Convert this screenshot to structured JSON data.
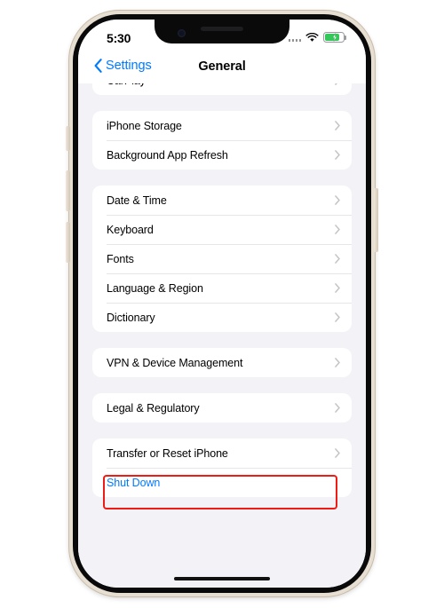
{
  "device": {
    "frame_color": "#e8dfd3",
    "bezel_color": "#0a0a0a"
  },
  "status_bar": {
    "time": "5:30",
    "cellular_icon": "cellular-dots-icon",
    "wifi_icon": "wifi-icon",
    "battery_icon": "battery-charging-icon",
    "battery_color": "#34c759"
  },
  "nav_bar": {
    "back_icon": "chevron-left-icon",
    "back_label": "Settings",
    "title": "General",
    "accent_color": "#007aff"
  },
  "highlight": {
    "color": "#ee1c15",
    "target": "Transfer or Reset iPhone"
  },
  "groups": [
    {
      "name": "carplay-group",
      "clipped": true,
      "rows": [
        {
          "label": "CarPlay",
          "chevron": true,
          "style": "default"
        }
      ]
    },
    {
      "name": "storage-group",
      "clipped": false,
      "rows": [
        {
          "label": "iPhone Storage",
          "chevron": true,
          "style": "default"
        },
        {
          "label": "Background App Refresh",
          "chevron": true,
          "style": "default"
        }
      ]
    },
    {
      "name": "localization-group",
      "clipped": false,
      "rows": [
        {
          "label": "Date & Time",
          "chevron": true,
          "style": "default"
        },
        {
          "label": "Keyboard",
          "chevron": true,
          "style": "default"
        },
        {
          "label": "Fonts",
          "chevron": true,
          "style": "default"
        },
        {
          "label": "Language & Region",
          "chevron": true,
          "style": "default"
        },
        {
          "label": "Dictionary",
          "chevron": true,
          "style": "default"
        }
      ]
    },
    {
      "name": "vpn-group",
      "clipped": false,
      "rows": [
        {
          "label": "VPN & Device Management",
          "chevron": true,
          "style": "default"
        }
      ]
    },
    {
      "name": "legal-group",
      "clipped": false,
      "rows": [
        {
          "label": "Legal & Regulatory",
          "chevron": true,
          "style": "default"
        }
      ]
    },
    {
      "name": "reset-group",
      "clipped": false,
      "rows": [
        {
          "label": "Transfer or Reset iPhone",
          "chevron": true,
          "style": "default"
        },
        {
          "label": "Shut Down",
          "chevron": false,
          "style": "link"
        }
      ]
    }
  ]
}
